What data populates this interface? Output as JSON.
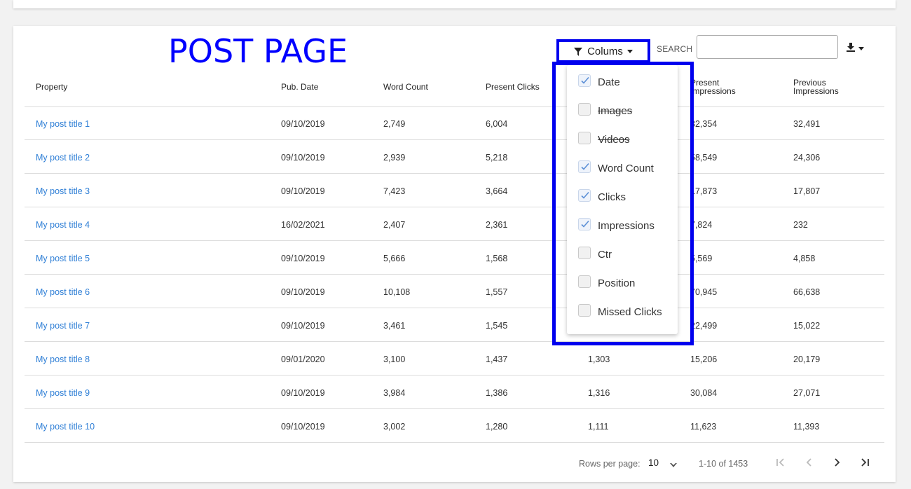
{
  "page_title": "POST PAGE",
  "toolbar": {
    "columns_label": "Colums",
    "search_label": "SEARCH",
    "search_value": "",
    "search_placeholder": ""
  },
  "table": {
    "headers": [
      "Property",
      "Pub. Date",
      "Word Count",
      "Present Clicks",
      "Present Impressions",
      "Previous Impressions"
    ],
    "header_lines": {
      "present_impressions": [
        "Present",
        "Impressions"
      ],
      "previous_impressions": [
        "Previous",
        "Impressions"
      ]
    },
    "rows": [
      {
        "property": "My post title 1",
        "pub_date": "09/10/2019",
        "word_count": "2,749",
        "present_clicks": "6,004",
        "col5": "",
        "present_impressions": "32,354",
        "previous_impressions": "32,491"
      },
      {
        "property": "My post title 2",
        "pub_date": "09/10/2019",
        "word_count": "2,939",
        "present_clicks": "5,218",
        "col5": "",
        "present_impressions": "58,549",
        "previous_impressions": "24,306"
      },
      {
        "property": "My post title 3",
        "pub_date": "09/10/2019",
        "word_count": "7,423",
        "present_clicks": "3,664",
        "col5": "",
        "present_impressions": "17,873",
        "previous_impressions": "17,807"
      },
      {
        "property": "My post title 4",
        "pub_date": "16/02/2021",
        "word_count": "2,407",
        "present_clicks": "2,361",
        "col5": "",
        "present_impressions": "7,824",
        "previous_impressions": "232"
      },
      {
        "property": "My post title 5",
        "pub_date": "09/10/2019",
        "word_count": "5,666",
        "present_clicks": "1,568",
        "col5": "",
        "present_impressions": "5,569",
        "previous_impressions": "4,858"
      },
      {
        "property": "My post title 6",
        "pub_date": "09/10/2019",
        "word_count": "10,108",
        "present_clicks": "1,557",
        "col5": "",
        "present_impressions": "70,945",
        "previous_impressions": "66,638"
      },
      {
        "property": "My post title 7",
        "pub_date": "09/10/2019",
        "word_count": "3,461",
        "present_clicks": "1,545",
        "col5": "",
        "present_impressions": "22,499",
        "previous_impressions": "15,022"
      },
      {
        "property": "My post title 8",
        "pub_date": "09/01/2020",
        "word_count": "3,100",
        "present_clicks": "1,437",
        "col5": "1,303",
        "present_impressions": "15,206",
        "previous_impressions": "20,179"
      },
      {
        "property": "My post title 9",
        "pub_date": "09/10/2019",
        "word_count": "3,984",
        "present_clicks": "1,386",
        "col5": "1,316",
        "present_impressions": "30,084",
        "previous_impressions": "27,071"
      },
      {
        "property": "My post title 10",
        "pub_date": "09/10/2019",
        "word_count": "3,002",
        "present_clicks": "1,280",
        "col5": "1,111",
        "present_impressions": "11,623",
        "previous_impressions": "11,393"
      }
    ]
  },
  "column_menu": {
    "options": [
      {
        "label": "Date",
        "checked": true,
        "disabled": false
      },
      {
        "label": "Images",
        "checked": false,
        "disabled": true
      },
      {
        "label": "Videos",
        "checked": false,
        "disabled": true
      },
      {
        "label": "Word Count",
        "checked": true,
        "disabled": false
      },
      {
        "label": "Clicks",
        "checked": true,
        "disabled": false
      },
      {
        "label": "Impressions",
        "checked": true,
        "disabled": false
      },
      {
        "label": "Ctr",
        "checked": false,
        "disabled": false
      },
      {
        "label": "Position",
        "checked": false,
        "disabled": false
      },
      {
        "label": "Missed Clicks",
        "checked": false,
        "disabled": false
      }
    ]
  },
  "pagination": {
    "rows_per_page_label": "Rows per page:",
    "rows_per_page_value": "10",
    "range_label": "1-10 of 1453"
  },
  "colors": {
    "accent_blue": "#0000ee",
    "link_blue": "#2f7fd6",
    "check_blue": "#5b8fd6"
  },
  "icons": [
    "filter-icon",
    "download-icon",
    "caret-down-icon",
    "first-page-icon",
    "previous-page-icon",
    "next-page-icon",
    "last-page-icon",
    "checkmark-icon"
  ]
}
